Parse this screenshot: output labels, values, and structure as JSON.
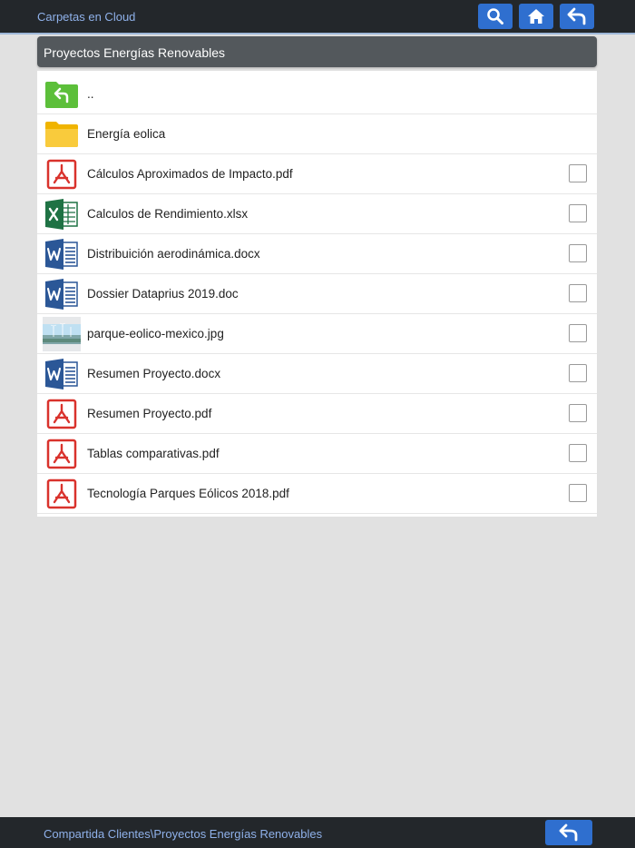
{
  "topbar": {
    "title": "Carpetas en Cloud",
    "buttons": [
      "search-icon",
      "home-icon",
      "back-arrow-icon"
    ]
  },
  "panel": {
    "title": "Proyectos Energías Renovables"
  },
  "items": [
    {
      "name": "..",
      "type": "folder-up",
      "checkbox": false
    },
    {
      "name": "Energía eolica",
      "type": "folder",
      "checkbox": false
    },
    {
      "name": "Cálculos Aproximados de Impacto.pdf",
      "type": "pdf",
      "checkbox": true
    },
    {
      "name": "Calculos de Rendimiento.xlsx",
      "type": "excel",
      "checkbox": true
    },
    {
      "name": "Distribuición aerodinámica.docx",
      "type": "word",
      "checkbox": true
    },
    {
      "name": "Dossier Dataprius 2019.doc",
      "type": "word",
      "checkbox": true
    },
    {
      "name": "parque-eolico-mexico.jpg",
      "type": "image",
      "checkbox": true
    },
    {
      "name": "Resumen Proyecto.docx",
      "type": "word",
      "checkbox": true
    },
    {
      "name": "Resumen Proyecto.pdf",
      "type": "pdf",
      "checkbox": true
    },
    {
      "name": "Tablas comparativas.pdf",
      "type": "pdf",
      "checkbox": true
    },
    {
      "name": "Tecnología Parques Eólicos 2018.pdf",
      "type": "pdf",
      "checkbox": true
    }
  ],
  "bottombar": {
    "path": "Compartida Clientes\\Proyectos Energías Renovables"
  },
  "colors": {
    "accent": "#2f6fcf",
    "bar": "#23272b",
    "header": "#53585c",
    "pdf": "#d9322c",
    "excel": "#1f7244",
    "word": "#2b5797",
    "folder": "#f6c026",
    "folder_up": "#5cbf3a"
  }
}
